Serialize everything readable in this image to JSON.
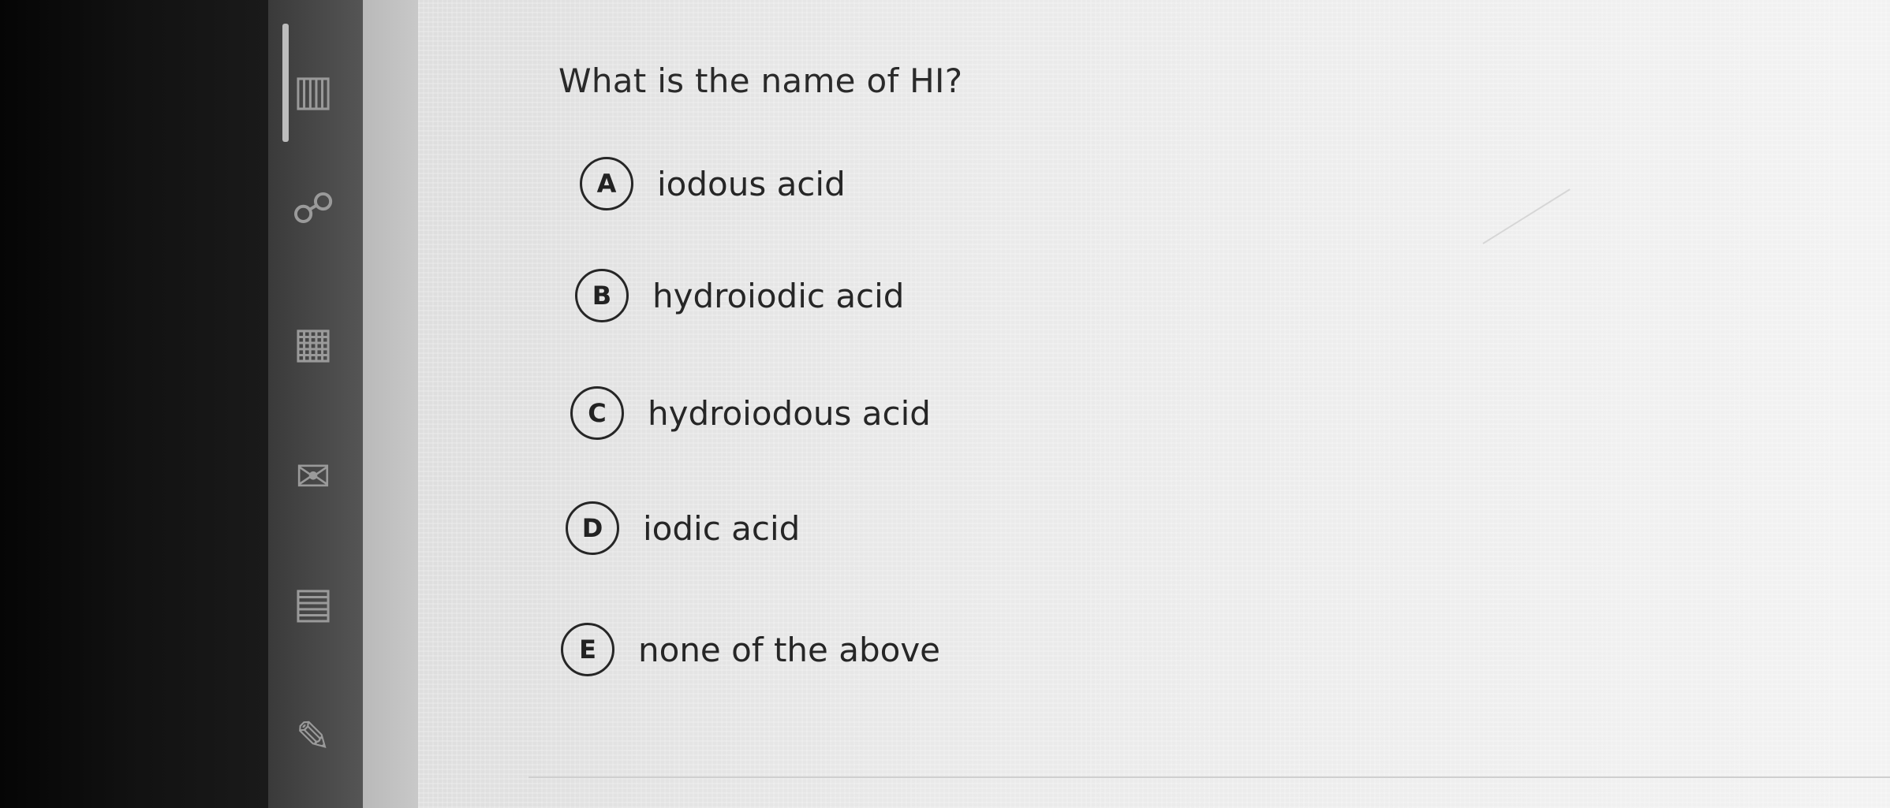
{
  "question": {
    "text": "What is the name of HI?"
  },
  "options": [
    {
      "letter": "A",
      "text": "iodous acid"
    },
    {
      "letter": "B",
      "text": "hydroiodic acid"
    },
    {
      "letter": "C",
      "text": "hydroiodous acid"
    },
    {
      "letter": "D",
      "text": "iodic acid"
    },
    {
      "letter": "E",
      "text": "none of the above"
    }
  ],
  "nav_icons": [
    "document-icon",
    "people-icon",
    "calendar-icon",
    "mail-icon",
    "notes-icon",
    "tools-icon"
  ],
  "colors": {
    "text": "#262626",
    "panel_background": "#ececec",
    "nav_rail": "#4a4a4a"
  }
}
